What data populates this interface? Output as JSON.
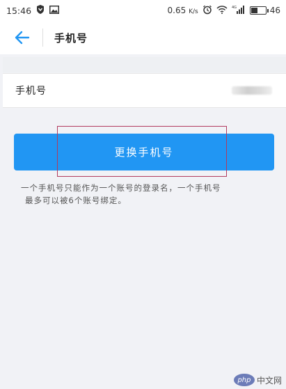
{
  "status_bar": {
    "time": "15:46",
    "speed": "0.65",
    "speed_unit": "K/s",
    "network": "4G",
    "battery": "46"
  },
  "header": {
    "back_icon": "arrow-left-icon",
    "title": "手机号"
  },
  "phone": {
    "label": "手机号",
    "value": ""
  },
  "actions": {
    "change_label": "更换手机号"
  },
  "hint": {
    "line1": "一个手机号只能作为一个账号的登录名，一个手机号",
    "line2": "最多可以被6个账号绑定。"
  },
  "watermark": {
    "badge": "php",
    "text": "中文网"
  },
  "colors": {
    "accent": "#2196f3",
    "highlight": "#b23a5e"
  }
}
